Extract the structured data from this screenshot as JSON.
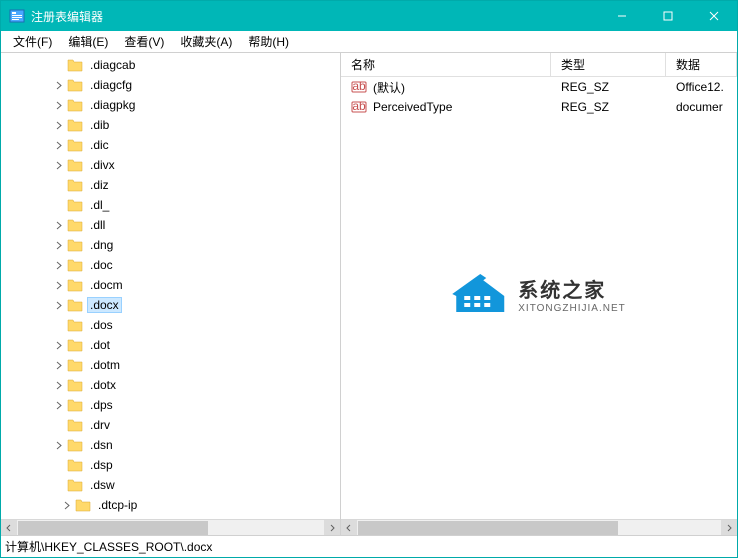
{
  "window": {
    "title": "注册表编辑器"
  },
  "menu": {
    "file": "文件(F)",
    "edit": "编辑(E)",
    "view": "查看(V)",
    "favorites": "收藏夹(A)",
    "help": "帮助(H)"
  },
  "tree": {
    "items": [
      {
        "label": ".diagcab",
        "depth": 3,
        "expandable": false,
        "selected": false
      },
      {
        "label": ".diagcfg",
        "depth": 3,
        "expandable": true,
        "selected": false
      },
      {
        "label": ".diagpkg",
        "depth": 3,
        "expandable": true,
        "selected": false
      },
      {
        "label": ".dib",
        "depth": 3,
        "expandable": true,
        "selected": false
      },
      {
        "label": ".dic",
        "depth": 3,
        "expandable": true,
        "selected": false
      },
      {
        "label": ".divx",
        "depth": 3,
        "expandable": true,
        "selected": false
      },
      {
        "label": ".diz",
        "depth": 3,
        "expandable": false,
        "selected": false
      },
      {
        "label": ".dl_",
        "depth": 3,
        "expandable": false,
        "selected": false
      },
      {
        "label": ".dll",
        "depth": 3,
        "expandable": true,
        "selected": false
      },
      {
        "label": ".dng",
        "depth": 3,
        "expandable": true,
        "selected": false
      },
      {
        "label": ".doc",
        "depth": 3,
        "expandable": true,
        "selected": false
      },
      {
        "label": ".docm",
        "depth": 3,
        "expandable": true,
        "selected": false
      },
      {
        "label": ".docx",
        "depth": 3,
        "expandable": true,
        "selected": true
      },
      {
        "label": ".dos",
        "depth": 3,
        "expandable": false,
        "selected": false
      },
      {
        "label": ".dot",
        "depth": 3,
        "expandable": true,
        "selected": false
      },
      {
        "label": ".dotm",
        "depth": 3,
        "expandable": true,
        "selected": false
      },
      {
        "label": ".dotx",
        "depth": 3,
        "expandable": true,
        "selected": false
      },
      {
        "label": ".dps",
        "depth": 3,
        "expandable": true,
        "selected": false
      },
      {
        "label": ".drv",
        "depth": 3,
        "expandable": false,
        "selected": false
      },
      {
        "label": ".dsn",
        "depth": 3,
        "expandable": true,
        "selected": false
      },
      {
        "label": ".dsp",
        "depth": 3,
        "expandable": false,
        "selected": false
      },
      {
        "label": ".dsw",
        "depth": 3,
        "expandable": false,
        "selected": false
      },
      {
        "label": ".dtcp-ip",
        "depth": 4,
        "expandable": true,
        "selected": false
      }
    ]
  },
  "list": {
    "columns": {
      "name": "名称",
      "type": "类型",
      "data": "数据"
    },
    "rows": [
      {
        "name": "(默认)",
        "type": "REG_SZ",
        "data": "Office12."
      },
      {
        "name": "PerceivedType",
        "type": "REG_SZ",
        "data": "documer"
      }
    ]
  },
  "statusbar": {
    "path": "计算机\\HKEY_CLASSES_ROOT\\.docx"
  },
  "watermark": {
    "title": "系统之家",
    "sub": "XITONGZHIJIA.NET"
  }
}
